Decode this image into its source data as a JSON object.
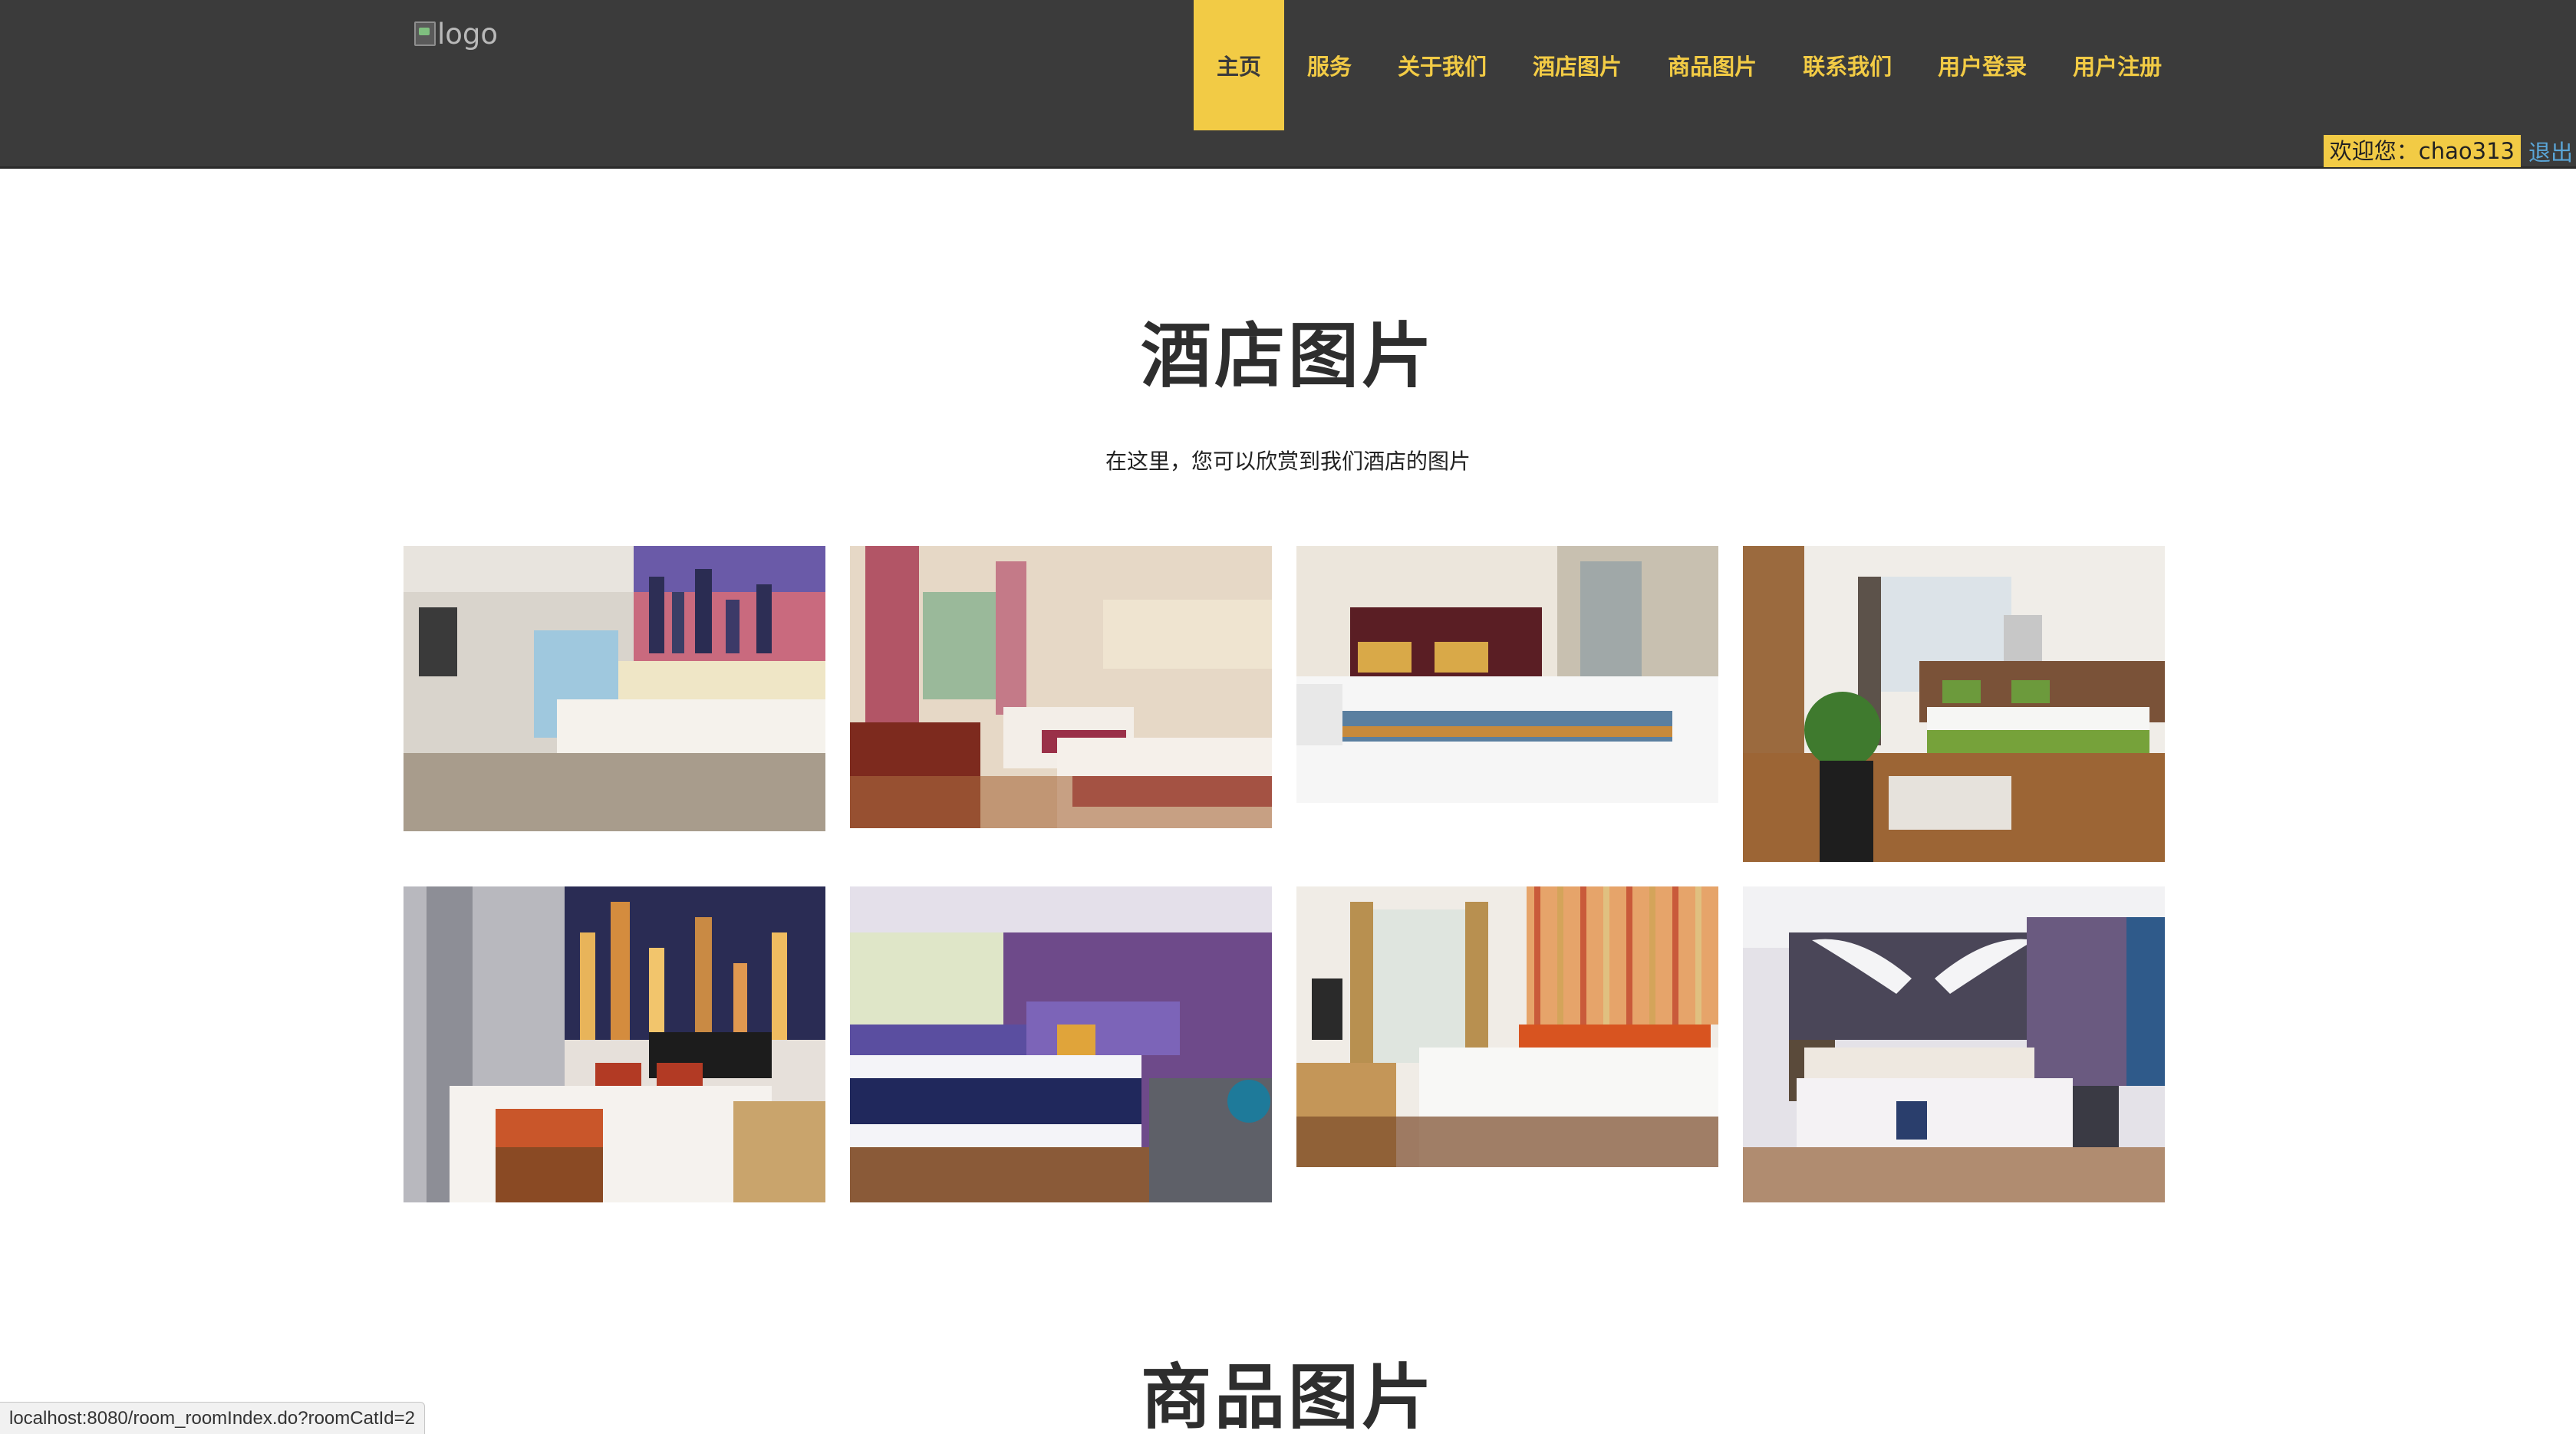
{
  "header": {
    "logo_alt": "logo",
    "nav": [
      {
        "label": "主页",
        "active": true
      },
      {
        "label": "服务",
        "active": false
      },
      {
        "label": "关于我们",
        "active": false
      },
      {
        "label": "酒店图片",
        "active": false
      },
      {
        "label": "商品图片",
        "active": false
      },
      {
        "label": "联系我们",
        "active": false
      },
      {
        "label": "用户登录",
        "active": false
      },
      {
        "label": "用户注册",
        "active": false
      }
    ],
    "welcome_text": "欢迎您：chao313",
    "logout_label": "退出"
  },
  "hotel_section": {
    "title": "酒店图片",
    "subtitle": "在这里，您可以欣赏到我们酒店的图片"
  },
  "goods_section": {
    "title": "商品图片"
  },
  "status_bar": {
    "url": "localhost:8080/room_roomIndex.do?roomCatId=2"
  },
  "colors": {
    "header_bg": "#3b3b3b",
    "accent": "#f2cb45",
    "link": "#5aa6d8"
  }
}
